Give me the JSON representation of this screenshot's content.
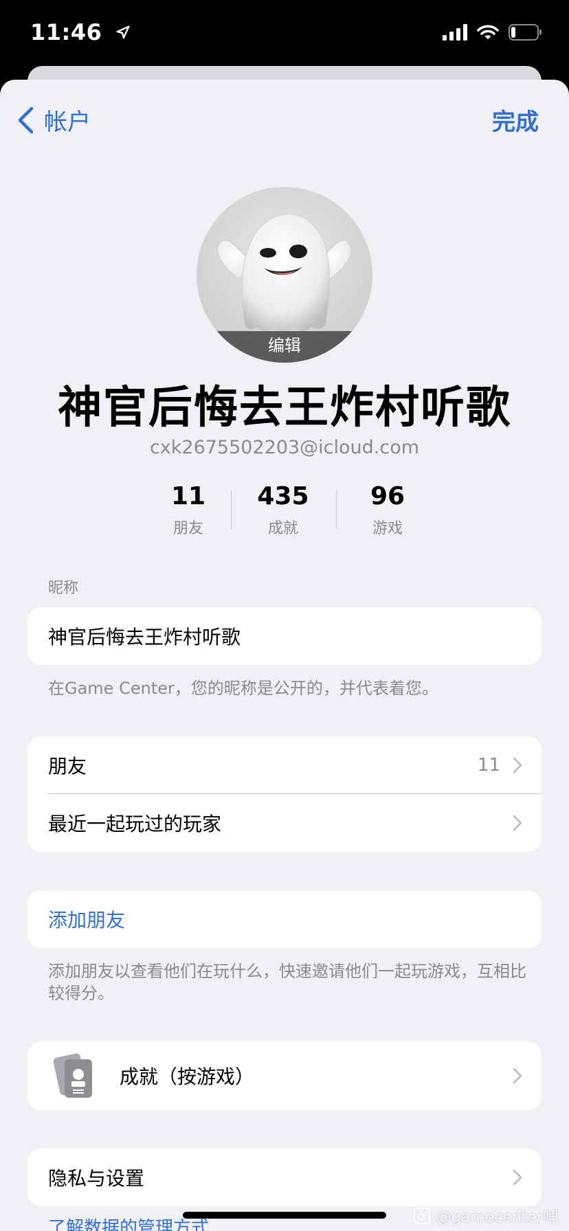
{
  "status_bar": {
    "time": "11:46",
    "icons": [
      "location-arrow-icon",
      "signal-icon",
      "wifi-icon",
      "battery-icon"
    ]
  },
  "nav": {
    "back_label": "帐户",
    "done_label": "完成",
    "accent_color": "#2f6fd6"
  },
  "profile": {
    "avatar_icon": "ghost-memoji-icon",
    "edit_label": "编辑",
    "name": "神官后悔去王炸村听歌",
    "email": "cxk2675502203@icloud.com",
    "stats": [
      {
        "value": "11",
        "label": "朋友"
      },
      {
        "value": "435",
        "label": "成就"
      },
      {
        "value": "96",
        "label": "游戏"
      }
    ]
  },
  "nickname_section": {
    "header": "昵称",
    "value": "神官后悔去王炸村听歌",
    "footer": "在Game Center，您的昵称是公开的，并代表着您。"
  },
  "friends_section": {
    "rows": [
      {
        "label": "朋友",
        "value": "11"
      },
      {
        "label": "最近一起玩过的玩家",
        "value": ""
      }
    ]
  },
  "add_friends": {
    "label": "添加朋友",
    "footer": "添加朋友以查看他们在玩什么，快速邀请他们一起玩游戏，互相比较得分。"
  },
  "achievements": {
    "icon": "achievement-cards-icon",
    "label": "成就（按游戏）"
  },
  "privacy": {
    "label": "隐私与设置",
    "footer_link": "了解数据的管理方式"
  },
  "watermark": {
    "text": "@gamecenter吧"
  }
}
